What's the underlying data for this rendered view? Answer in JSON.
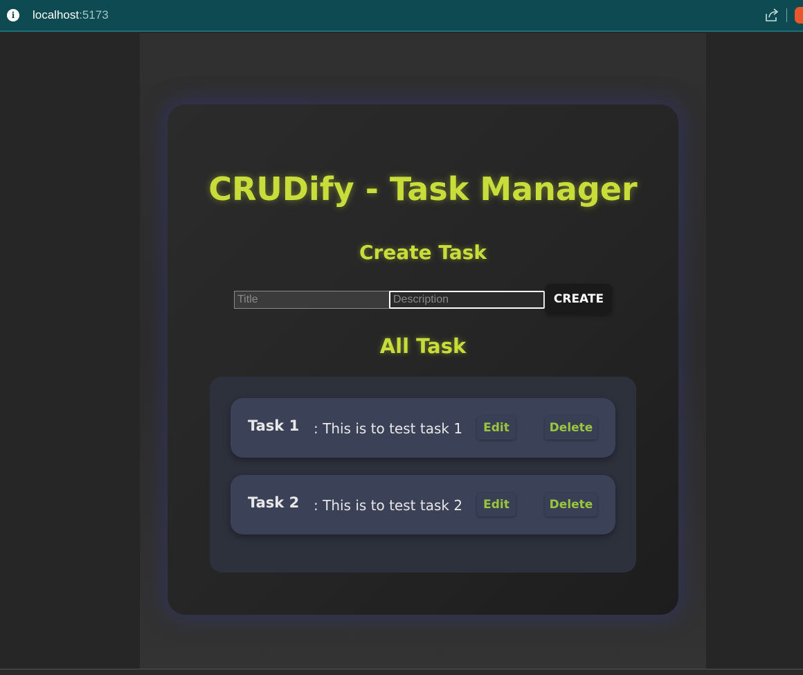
{
  "browser": {
    "host": "localhost",
    "port": ":5173"
  },
  "app": {
    "title": "CRUDify - Task Manager",
    "create_heading": "Create Task",
    "title_placeholder": "Title",
    "description_placeholder": "Description",
    "create_label": "CREATE",
    "all_heading": "All Task"
  },
  "tasks": [
    {
      "name": "Task 1",
      "description": ": This is to test task 1",
      "edit_label": "Edit",
      "delete_label": "Delete"
    },
    {
      "name": "Task 2",
      "description": ": This is to test task 2",
      "edit_label": "Edit",
      "delete_label": "Delete"
    }
  ],
  "colors": {
    "accent": "#c8dc3a",
    "button_text": "#9bc53d",
    "browser_bar": "#0d4a52"
  },
  "icons": {
    "info": "info-icon",
    "share": "share-icon",
    "brave": "brave-icon"
  }
}
